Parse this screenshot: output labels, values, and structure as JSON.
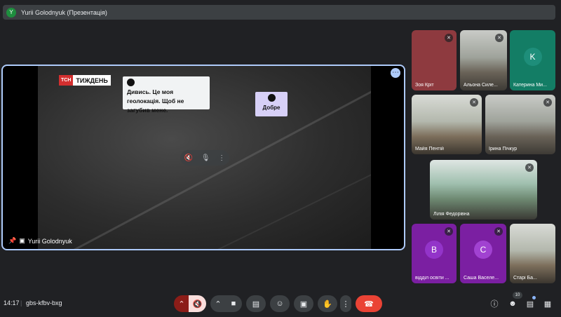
{
  "topbar": {
    "avatar_letter": "Y",
    "title": "Yurii Golodnyuk (Презентація)"
  },
  "presentation": {
    "logo_red": "ТСН",
    "logo_white": "ТИЖДЕНЬ",
    "bubble_1": "Дивись. Це моя геолокація. Щоб не загубив мене.",
    "bubble_2": "Добре",
    "presenter_name": "Yurii Golodnyuk"
  },
  "participants": [
    {
      "name": "Зоя Кріт",
      "type": "video",
      "style": "#8e3a3f"
    },
    {
      "name": "Альона Силе...",
      "type": "video",
      "style": "classroom"
    },
    {
      "name": "Катерина Ми...",
      "type": "avatar",
      "letter": "K",
      "bg": "#137d65",
      "avatar_color": "#1e8e7a"
    },
    {
      "name": "Майя Пентій",
      "type": "video",
      "style": "classroom2"
    },
    {
      "name": "Ірина Пічкур",
      "type": "video",
      "style": "classroom"
    },
    {
      "name": "Лілія Федорівна",
      "type": "video",
      "style": "green-room"
    },
    {
      "name": "відділ освіти ...",
      "type": "avatar",
      "letter": "B",
      "bg": "#7b1fa2",
      "avatar_color": "#9334c9"
    },
    {
      "name": "Саша Васеле...",
      "type": "avatar",
      "letter": "C",
      "bg": "#7b1fa2",
      "avatar_color": "#a142d1"
    },
    {
      "name": "Старі Ба...",
      "type": "video",
      "style": "classroom2"
    }
  ],
  "bottombar": {
    "time": "14:17",
    "separator": "|",
    "meeting_code": "gbs-kfbv-bxg",
    "participant_count": "10"
  },
  "colors": {
    "accent": "#aecbfa",
    "end_call": "#ea4335",
    "mic_off_bg": "#f9dedc"
  }
}
